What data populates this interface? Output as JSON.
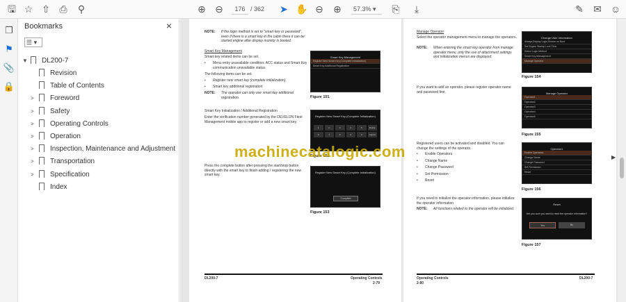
{
  "toolbar": {
    "current_page": "176",
    "total_pages": "/ 362",
    "zoom": "57.3%",
    "icons": [
      "save-icon",
      "star-icon",
      "upload-icon",
      "print-icon",
      "search-icon",
      "page-up-icon",
      "page-down-icon",
      "cursor-icon",
      "hand-icon",
      "zoom-out-icon",
      "zoom-in-icon",
      "page-fit-icon",
      "scroll-mode-icon",
      "sign-icon",
      "mail-icon",
      "account-icon"
    ]
  },
  "sidebar": {
    "title": "Bookmarks",
    "options": "☰ ▾",
    "root": "DL200-7",
    "items": [
      {
        "label": "Revision",
        "expandable": false
      },
      {
        "label": "Table of Contents",
        "expandable": false
      },
      {
        "label": "Foreword",
        "expandable": true
      },
      {
        "label": "Safety",
        "expandable": true
      },
      {
        "label": "Operating Controls",
        "expandable": true
      },
      {
        "label": "Operation",
        "expandable": true
      },
      {
        "label": "Inspection, Maintenance and Adjustment",
        "expandable": true
      },
      {
        "label": "Transportation",
        "expandable": true
      },
      {
        "label": "Specification",
        "expandable": true
      },
      {
        "label": "Index",
        "expandable": false
      }
    ]
  },
  "watermark": "machinecatalogic.com",
  "page_left": {
    "note1_label": "NOTE:",
    "note1": "If the login method is set to \"smart key or password\", even if there is a smart key in the cabin there it can be started engine after display monitor is booted.",
    "h1": "Smart Key Management",
    "p1": "Smart key related items can be set.",
    "b1": "Menu entry unavailable condition: ACC status and Smart Key communication unavailable status.",
    "p2": "The following items can be set.",
    "b2": "Register new smart key (complete initialization)",
    "b3": "Smart key additional registration",
    "note2_label": "NOTE:",
    "note2": "The operator can only use smart key additional registration.",
    "h2": "Smart Key Initialization / Additional Registration",
    "p3": "Enter the verification number generated by the DEVELON Fleet Management mobile app to register or add a new smart key.",
    "p4": "Press the complete button after pressing the start/stop button directly with the smart key to finish adding / registering the new smart key.",
    "fig151": "Figure 151",
    "fig152": "Figure 152",
    "fig153": "Figure 153",
    "scr151_title": "Smart Key Management",
    "scr151_rows": [
      "Register New Smart Key (Complete Initialization)",
      "Smart Key Additional Registration"
    ],
    "scr152_title": "Register New Smart Key (Complete Initialization)",
    "scr152_keys": [
      "1",
      "2",
      "3",
      "4",
      "5",
      "Delete",
      "6",
      "7",
      "8",
      "9",
      "0",
      "Cancel"
    ],
    "scr153_title": "Register New Smart Key (Complete Initialization)",
    "scr153_btn": "Complete",
    "footer_model": "DL200-7",
    "footer_section": "Operating Controls",
    "footer_page": "2-79"
  },
  "page_right": {
    "h1": "Manage Operator",
    "p1": "Select the operator management menu to manage the operators.",
    "note1_label": "NOTE:",
    "note1": "When entering the smart key operator from manage operator menu, only the use of attachment settings and initialization menus are displayed.",
    "p2": "If you want to add an operator, please register operator name and password first.",
    "p3": "Registered users can be activated and disabled. You can change the settings of the operator.",
    "bullets": [
      "Enable Operators",
      "Change Name",
      "Change Password",
      "Set Permission",
      "Reset"
    ],
    "p4": "If you need to initialize the operator information, please initialize the operator information.",
    "note2_label": "NOTE:",
    "note2": "All functions related to the operator will be initialized.",
    "fig154": "Figure 154",
    "fig155": "Figure 155",
    "fig156": "Figure 156",
    "fig157": "Figure 157",
    "scr154_title": "Change User Information",
    "scr154_rows": [
      "Always Display Login Screen on Boot",
      "Set Engine Startup Lock Time",
      "Select Login Method",
      "Smart Key Management",
      "Manage Operator"
    ],
    "scr155_title": "Manage Operator",
    "scr155_rows": [
      "Operator1",
      "Operator2",
      "Operator3",
      "Operator4",
      "Operator5"
    ],
    "scr156_title": "Operator1",
    "scr156_rows": [
      "Enable Operators",
      "Change Name",
      "Change Password",
      "Set Permission",
      "Reset"
    ],
    "scr157_title": "Reset",
    "scr157_q": "Are you sure you want to reset the operator information?",
    "scr157_yes": "Yes",
    "scr157_no": "No",
    "footer_section": "Operating Controls",
    "footer_page": "2-80",
    "footer_model": "DL200-7"
  }
}
